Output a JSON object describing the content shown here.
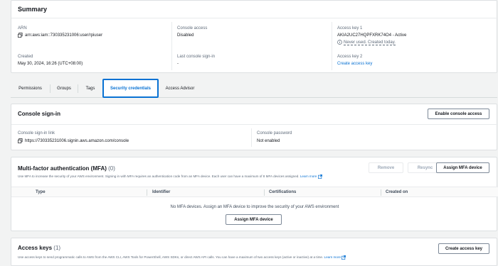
{
  "summary": {
    "title": "Summary",
    "arn_label": "ARN",
    "arn_value": "arn:aws:iam::730335231006:user/rpiuser",
    "created_label": "Created",
    "created_value": "May 30, 2024, 16:26 (UTC+08:00)",
    "console_access_label": "Console access",
    "console_access_value": "Disabled",
    "last_signin_label": "Last console sign-in",
    "last_signin_value": "-",
    "access_key1_label": "Access key 1",
    "access_key1_value": "AKIA2UC27HQPFXRK74O4 - Active",
    "access_key1_note": "Never used. Created today.",
    "access_key2_label": "Access key 2",
    "access_key2_link": "Create access key"
  },
  "tabs": [
    "Permissions",
    "Groups",
    "Tags",
    "Security credentials",
    "Access Advisor"
  ],
  "console_signin": {
    "title": "Console sign-in",
    "enable_button": "Enable console access",
    "link_label": "Console sign-in link",
    "link_value": "https://730335231006.signin.aws.amazon.com/console",
    "password_label": "Console password",
    "password_value": "Not enabled"
  },
  "mfa": {
    "title": "Multi-factor authentication (MFA)",
    "count": "(0)",
    "description": "Use MFA to increase the security of your AWS environment. Signing in with MFA requires an authentication code from an MFA device. Each user can have a maximum of 8 MFA devices assigned.",
    "learn_more": "Learn more",
    "remove_button": "Remove",
    "resync_button": "Resync",
    "assign_button": "Assign MFA device",
    "columns": [
      "Type",
      "Identifier",
      "Certifications",
      "Created on"
    ],
    "empty_text": "No MFA devices. Assign an MFA device to improve the security of your AWS environment",
    "empty_assign_button": "Assign MFA device"
  },
  "access_keys": {
    "title": "Access keys",
    "count": "(1)",
    "description": "Use access keys to send programmatic calls to AWS from the AWS CLI, AWS Tools for PowerShell, AWS SDKs, or direct AWS API calls. You can have a maximum of two access keys (active or inactive) at a time.",
    "learn_more": "Learn more",
    "create_button": "Create access key"
  },
  "colors": {
    "accent": "#0972d3",
    "text": "#16191f",
    "muted": "#5f6b7a",
    "background": "#f2f3f3"
  }
}
